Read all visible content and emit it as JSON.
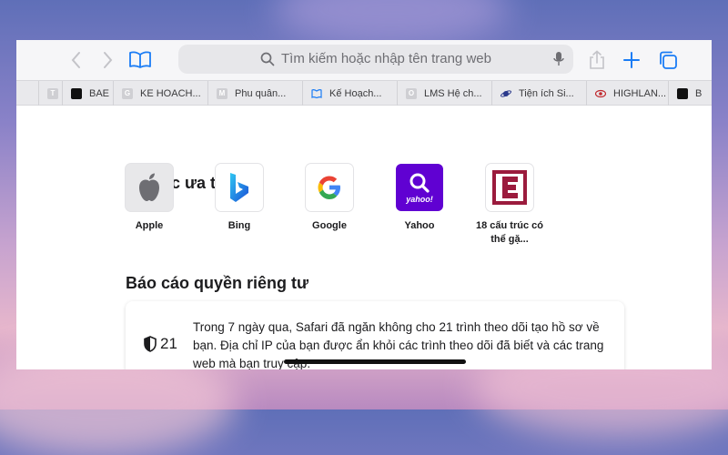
{
  "toolbar": {
    "address_placeholder": "Tìm kiếm hoặc nhập tên trang web"
  },
  "tabs": [
    {
      "label": "",
      "favicon": "T"
    },
    {
      "label": "BAE",
      "favicon": "B"
    },
    {
      "label": "KE HOACH...",
      "favicon": "G"
    },
    {
      "label": "Phu quân...",
      "favicon": "M"
    },
    {
      "label": "Kế Hoạch...",
      "favicon": "book"
    },
    {
      "label": "LMS Hệ ch...",
      "favicon": "O"
    },
    {
      "label": "Tiện ích Si...",
      "favicon": "planet"
    },
    {
      "label": "HIGHLAN...",
      "favicon": "eye"
    },
    {
      "label": "B",
      "favicon": "B"
    }
  ],
  "favorites": {
    "title": "Mục ưa thích",
    "items": [
      {
        "label": "Apple"
      },
      {
        "label": "Bing"
      },
      {
        "label": "Google"
      },
      {
        "label": "Yahoo"
      },
      {
        "label": "18 cấu trúc có thể gặ..."
      }
    ]
  },
  "privacy": {
    "title": "Báo cáo quyền riêng tư",
    "count": "21",
    "text": "Trong 7 ngày qua, Safari đã ngăn không cho 21 trình theo dõi tạo hồ sơ về bạn. Địa chỉ IP của bạn được ẩn khỏi các trình theo dõi đã biết và các trang web mà bạn truy cập."
  },
  "colors": {
    "accent": "#007aff",
    "yahoo": "#6001d2",
    "e_tile": "#9b1b3d"
  }
}
